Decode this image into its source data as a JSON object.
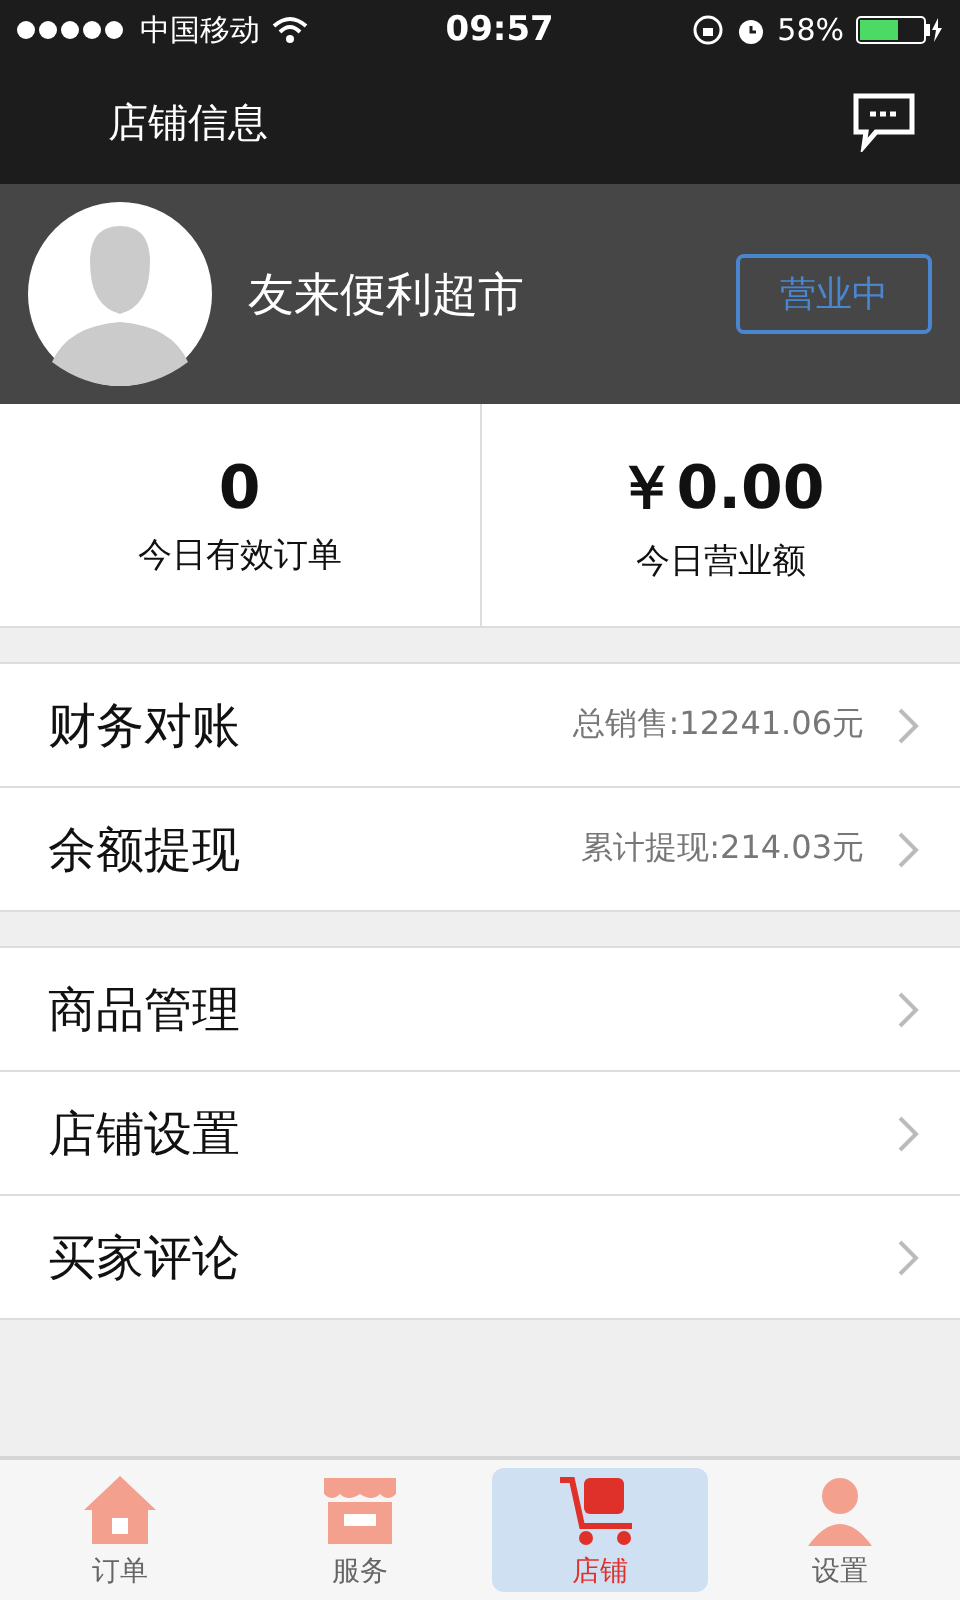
{
  "status_bar": {
    "carrier": "中国移动",
    "time": "09:57",
    "battery": "58%"
  },
  "header": {
    "title": "店铺信息"
  },
  "profile": {
    "name": "友来便利超市",
    "status": "营业中"
  },
  "stats": [
    {
      "value": "0",
      "label": "今日有效订单"
    },
    {
      "value": "￥0.00",
      "label": "今日营业额"
    }
  ],
  "groups": [
    [
      {
        "label": "财务对账",
        "detail": "总销售:12241.06元"
      },
      {
        "label": "余额提现",
        "detail": "累计提现:214.03元"
      }
    ],
    [
      {
        "label": "商品管理"
      },
      {
        "label": "店铺设置"
      },
      {
        "label": "买家评论"
      }
    ]
  ],
  "tabs": [
    {
      "kind": "home",
      "label": "订单",
      "selected": false
    },
    {
      "kind": "shop",
      "label": "服务",
      "selected": false
    },
    {
      "kind": "cart",
      "label": "店铺",
      "selected": true
    },
    {
      "kind": "person",
      "label": "设置",
      "selected": false
    }
  ]
}
